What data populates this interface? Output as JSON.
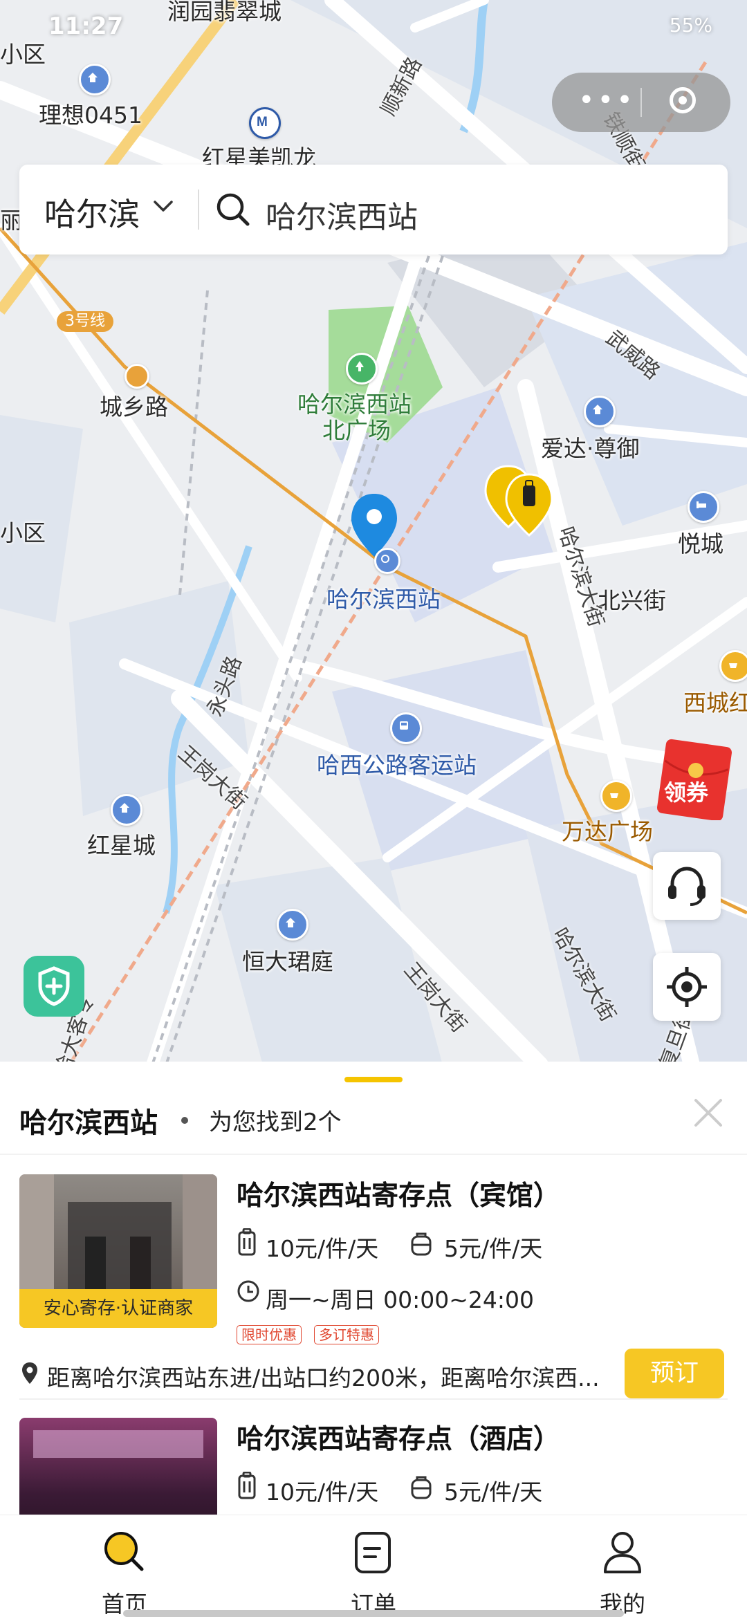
{
  "status_bar": {
    "time": "11:27",
    "battery": "55%"
  },
  "mini_program_capsule": {
    "more": "•••"
  },
  "search": {
    "city": "哈尔滨",
    "query": "哈尔滨西站"
  },
  "map": {
    "labels": {
      "runyuan": "润园翡翠城",
      "xiaoqu_top": "小区",
      "lixiang": "理想0451",
      "hongxing_mei": "红星美凯龙",
      "li": "丽",
      "line3": "3号线",
      "chengxiang": "城乡路",
      "west_station_north": "哈尔滨西站",
      "north_plaza": "北广场",
      "aida": "爱达·尊御",
      "xiaoqu_mid": "小区",
      "yuecheng": "悦城",
      "west_station": "哈尔滨西站",
      "beixing": "北兴街",
      "xicheng": "西城红",
      "haxi_bus": "哈西公路客运站",
      "wanda": "万达广场",
      "hongxingcheng": "红星城",
      "hengda": "恒大珺庭",
      "coupon": "领券"
    },
    "roads": {
      "shunxin": "顺新路",
      "tieshun": "铁顺街",
      "wuwei": "武威路",
      "harbin_ave": "哈尔滨大街",
      "yongtou": "永头路",
      "wanggang_ave": "王岗大街",
      "wanggang_ave2": "王岗大街",
      "harbin_ave2": "哈尔滨大街",
      "fudan": "复旦街",
      "ha_da": "哈大客专"
    }
  },
  "panel": {
    "location": "哈尔滨西站",
    "found": "为您找到2个"
  },
  "results": [
    {
      "title": "哈尔滨西站寄存点（宾馆）",
      "price_large": "10元/件/天",
      "price_small": "5元/件/天",
      "hours": "周一~周日 00:00~24:00",
      "badge": "安心寄存·认证商家",
      "tags": [
        "限时优惠",
        "多订特惠"
      ],
      "address": "距离哈尔滨西站东进/出站口约200米，距离哈尔滨西...",
      "button": "预订"
    },
    {
      "title": "哈尔滨西站寄存点（酒店）",
      "price_large": "10元/件/天",
      "price_small": "5元/件/天"
    }
  ],
  "tabbar": [
    {
      "label": "首页",
      "icon": "search-icon"
    },
    {
      "label": "订单",
      "icon": "order-icon"
    },
    {
      "label": "我的",
      "icon": "profile-icon"
    }
  ],
  "colors": {
    "accent": "#f6c724",
    "pin": "#1e8ae0",
    "metro": "#e8a23a",
    "shield": "#3cc39a"
  }
}
